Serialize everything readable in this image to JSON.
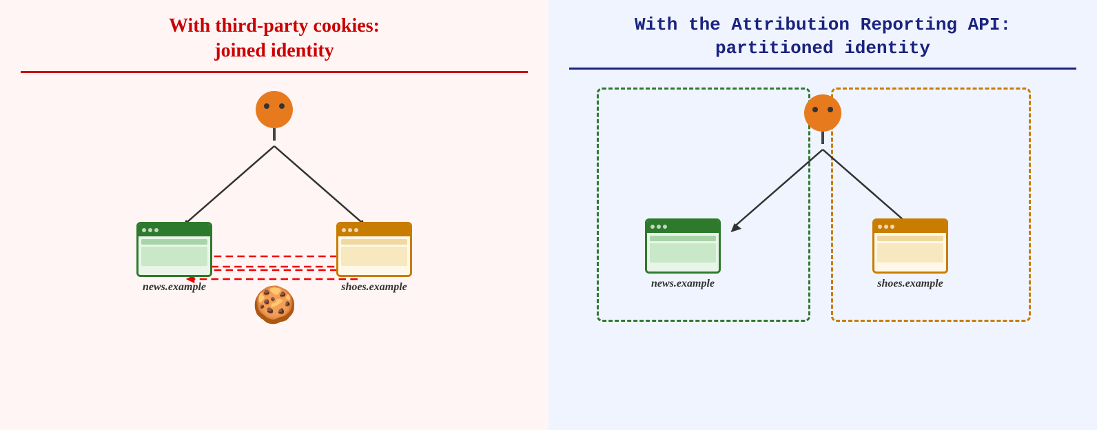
{
  "left_panel": {
    "title_line1": "With third-party cookies:",
    "title_line2": "joined identity",
    "background": "#fff5f5",
    "divider_color": "#cc0000",
    "title_color": "#cc0000",
    "site1_label": "news.example",
    "site2_label": "shoes.example"
  },
  "right_panel": {
    "title_line1": "With the Attribution Reporting API:",
    "title_line2": "partitioned identity",
    "background": "#f0f4ff",
    "divider_color": "#1a237e",
    "title_color": "#1a237e",
    "site1_label": "news.example",
    "site2_label": "shoes.example"
  }
}
